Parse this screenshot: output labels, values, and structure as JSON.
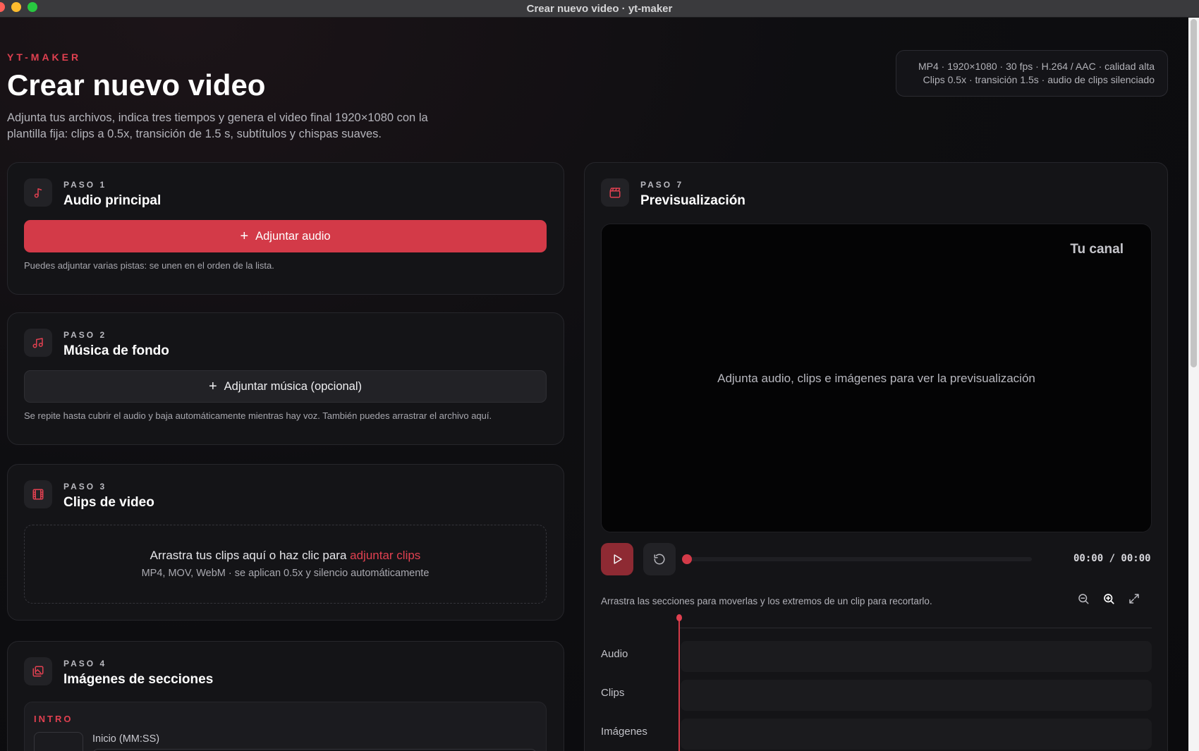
{
  "window": {
    "title": "Crear nuevo video · yt-maker"
  },
  "header": {
    "eyebrow": "YT-MAKER",
    "title": "Crear nuevo video",
    "subtitle_line1": "Adjunta tus archivos, indica tres tiempos y genera el video final 1920×1080 con la",
    "subtitle_line2": "plantilla fija: clips a 0.5x, transición de 1.5 s, subtítulos y chispas suaves."
  },
  "specs": {
    "line1": "MP4 · 1920×1080 · 30 fps · H.264 / AAC · calidad alta",
    "line2": "Clips 0.5x · transición 1.5s · audio de clips silenciado"
  },
  "step1": {
    "label": "PASO 1",
    "title": "Audio principal",
    "button": "Adjuntar audio",
    "hint": "Puedes adjuntar varias pistas: se unen en el orden de la lista."
  },
  "step2": {
    "label": "PASO 2",
    "title": "Música de fondo",
    "button": "Adjuntar música (opcional)",
    "hint": "Se repite hasta cubrir el audio y baja automáticamente mientras hay voz. También puedes arrastrar el archivo aquí."
  },
  "step3": {
    "label": "PASO 3",
    "title": "Clips de video",
    "drop_text": "Arrastra tus clips aquí o haz clic para ",
    "drop_link": "adjuntar clips",
    "drop_sub": "MP4, MOV, WebM · se aplican 0.5x y silencio automáticamente"
  },
  "step4": {
    "label": "PASO 4",
    "title": "Imágenes de secciones",
    "section": "INTRO",
    "field_label": "Inicio (MM:SS)"
  },
  "step7": {
    "label": "PASO 7",
    "title": "Previsualización",
    "channel": "Tu canal",
    "empty": "Adjunta audio, clips e imágenes para ver la previsualización",
    "time": "00:00 / 00:00",
    "progress": 0,
    "timeline_hint": "Arrastra las secciones para moverlas y los extremos de un clip para recortarlo.",
    "tracks": [
      "Audio",
      "Clips",
      "Imágenes"
    ]
  },
  "colors": {
    "accent": "#d33a48",
    "accent_text": "#e04050",
    "background": "#0d0d10",
    "card": "#141417"
  },
  "icons": {
    "step1": "music-note-icon",
    "step2": "music-notes-icon",
    "step3": "film-icon",
    "step4": "images-icon",
    "step7": "clapperboard-icon",
    "play": "play-icon",
    "restart": "restart-icon",
    "zoom_out": "zoom-out-icon",
    "zoom_in": "zoom-in-icon",
    "fit": "expand-icon"
  }
}
